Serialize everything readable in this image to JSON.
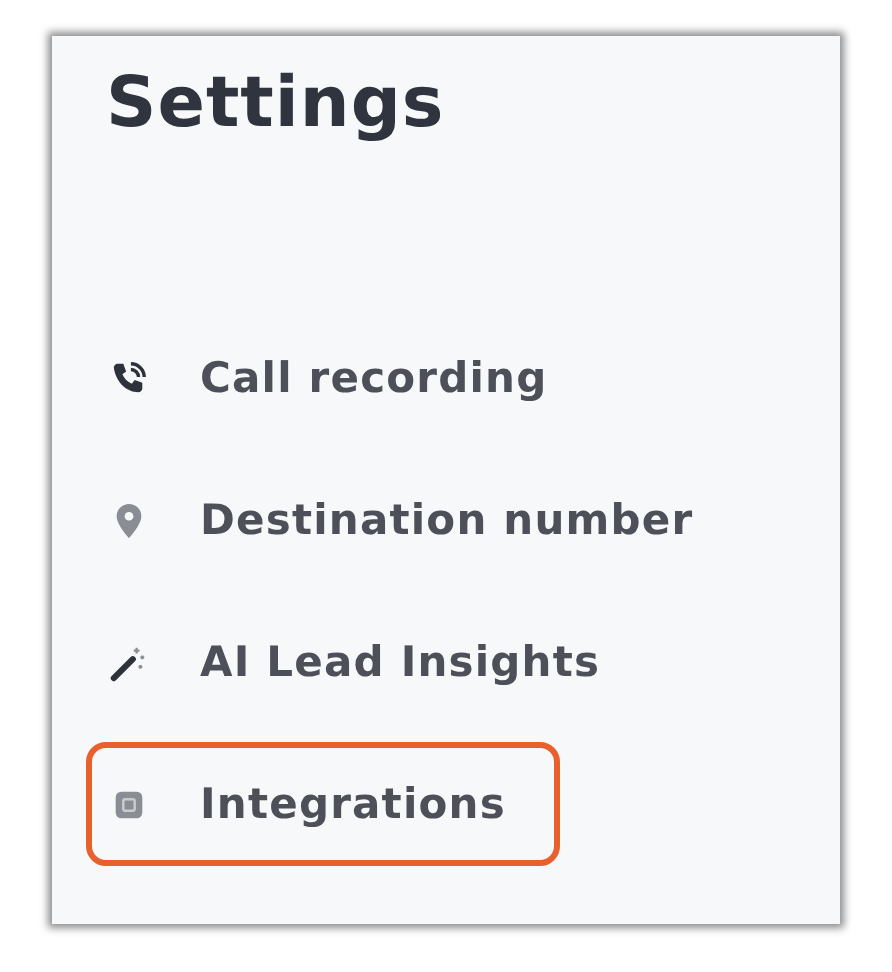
{
  "panel": {
    "title": "Settings"
  },
  "menu": [
    {
      "label": "Call recording",
      "selected": false
    },
    {
      "label": "Destination number",
      "selected": false
    },
    {
      "label": "AI Lead Insights",
      "selected": false
    },
    {
      "label": "Integrations",
      "selected": true
    }
  ]
}
